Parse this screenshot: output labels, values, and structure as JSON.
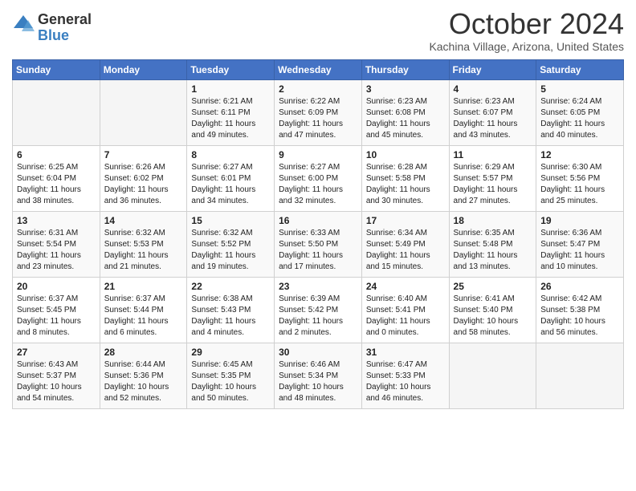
{
  "logo": {
    "general": "General",
    "blue": "Blue"
  },
  "header": {
    "month": "October 2024",
    "location": "Kachina Village, Arizona, United States"
  },
  "weekdays": [
    "Sunday",
    "Monday",
    "Tuesday",
    "Wednesday",
    "Thursday",
    "Friday",
    "Saturday"
  ],
  "weeks": [
    [
      {
        "day": "",
        "content": ""
      },
      {
        "day": "",
        "content": ""
      },
      {
        "day": "1",
        "content": "Sunrise: 6:21 AM\nSunset: 6:11 PM\nDaylight: 11 hours and 49 minutes."
      },
      {
        "day": "2",
        "content": "Sunrise: 6:22 AM\nSunset: 6:09 PM\nDaylight: 11 hours and 47 minutes."
      },
      {
        "day": "3",
        "content": "Sunrise: 6:23 AM\nSunset: 6:08 PM\nDaylight: 11 hours and 45 minutes."
      },
      {
        "day": "4",
        "content": "Sunrise: 6:23 AM\nSunset: 6:07 PM\nDaylight: 11 hours and 43 minutes."
      },
      {
        "day": "5",
        "content": "Sunrise: 6:24 AM\nSunset: 6:05 PM\nDaylight: 11 hours and 40 minutes."
      }
    ],
    [
      {
        "day": "6",
        "content": "Sunrise: 6:25 AM\nSunset: 6:04 PM\nDaylight: 11 hours and 38 minutes."
      },
      {
        "day": "7",
        "content": "Sunrise: 6:26 AM\nSunset: 6:02 PM\nDaylight: 11 hours and 36 minutes."
      },
      {
        "day": "8",
        "content": "Sunrise: 6:27 AM\nSunset: 6:01 PM\nDaylight: 11 hours and 34 minutes."
      },
      {
        "day": "9",
        "content": "Sunrise: 6:27 AM\nSunset: 6:00 PM\nDaylight: 11 hours and 32 minutes."
      },
      {
        "day": "10",
        "content": "Sunrise: 6:28 AM\nSunset: 5:58 PM\nDaylight: 11 hours and 30 minutes."
      },
      {
        "day": "11",
        "content": "Sunrise: 6:29 AM\nSunset: 5:57 PM\nDaylight: 11 hours and 27 minutes."
      },
      {
        "day": "12",
        "content": "Sunrise: 6:30 AM\nSunset: 5:56 PM\nDaylight: 11 hours and 25 minutes."
      }
    ],
    [
      {
        "day": "13",
        "content": "Sunrise: 6:31 AM\nSunset: 5:54 PM\nDaylight: 11 hours and 23 minutes."
      },
      {
        "day": "14",
        "content": "Sunrise: 6:32 AM\nSunset: 5:53 PM\nDaylight: 11 hours and 21 minutes."
      },
      {
        "day": "15",
        "content": "Sunrise: 6:32 AM\nSunset: 5:52 PM\nDaylight: 11 hours and 19 minutes."
      },
      {
        "day": "16",
        "content": "Sunrise: 6:33 AM\nSunset: 5:50 PM\nDaylight: 11 hours and 17 minutes."
      },
      {
        "day": "17",
        "content": "Sunrise: 6:34 AM\nSunset: 5:49 PM\nDaylight: 11 hours and 15 minutes."
      },
      {
        "day": "18",
        "content": "Sunrise: 6:35 AM\nSunset: 5:48 PM\nDaylight: 11 hours and 13 minutes."
      },
      {
        "day": "19",
        "content": "Sunrise: 6:36 AM\nSunset: 5:47 PM\nDaylight: 11 hours and 10 minutes."
      }
    ],
    [
      {
        "day": "20",
        "content": "Sunrise: 6:37 AM\nSunset: 5:45 PM\nDaylight: 11 hours and 8 minutes."
      },
      {
        "day": "21",
        "content": "Sunrise: 6:37 AM\nSunset: 5:44 PM\nDaylight: 11 hours and 6 minutes."
      },
      {
        "day": "22",
        "content": "Sunrise: 6:38 AM\nSunset: 5:43 PM\nDaylight: 11 hours and 4 minutes."
      },
      {
        "day": "23",
        "content": "Sunrise: 6:39 AM\nSunset: 5:42 PM\nDaylight: 11 hours and 2 minutes."
      },
      {
        "day": "24",
        "content": "Sunrise: 6:40 AM\nSunset: 5:41 PM\nDaylight: 11 hours and 0 minutes."
      },
      {
        "day": "25",
        "content": "Sunrise: 6:41 AM\nSunset: 5:40 PM\nDaylight: 10 hours and 58 minutes."
      },
      {
        "day": "26",
        "content": "Sunrise: 6:42 AM\nSunset: 5:38 PM\nDaylight: 10 hours and 56 minutes."
      }
    ],
    [
      {
        "day": "27",
        "content": "Sunrise: 6:43 AM\nSunset: 5:37 PM\nDaylight: 10 hours and 54 minutes."
      },
      {
        "day": "28",
        "content": "Sunrise: 6:44 AM\nSunset: 5:36 PM\nDaylight: 10 hours and 52 minutes."
      },
      {
        "day": "29",
        "content": "Sunrise: 6:45 AM\nSunset: 5:35 PM\nDaylight: 10 hours and 50 minutes."
      },
      {
        "day": "30",
        "content": "Sunrise: 6:46 AM\nSunset: 5:34 PM\nDaylight: 10 hours and 48 minutes."
      },
      {
        "day": "31",
        "content": "Sunrise: 6:47 AM\nSunset: 5:33 PM\nDaylight: 10 hours and 46 minutes."
      },
      {
        "day": "",
        "content": ""
      },
      {
        "day": "",
        "content": ""
      }
    ]
  ]
}
